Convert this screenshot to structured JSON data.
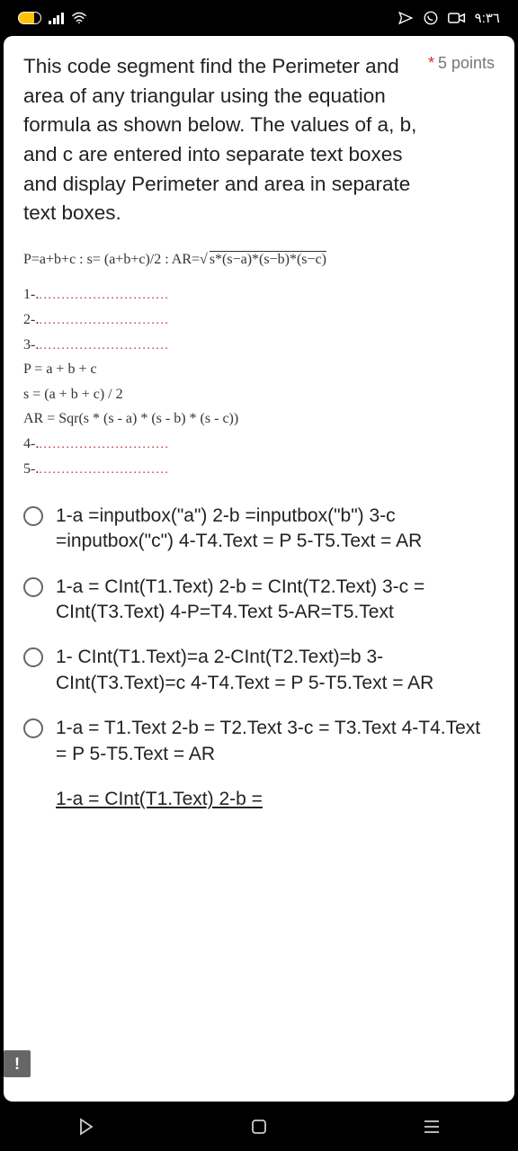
{
  "status": {
    "time": "٩:٣٦"
  },
  "question": {
    "text": "This code segment find the Perimeter and area of any triangular using the equation formula as shown below. The values of a, b, and c are entered into separate text boxes and display Perimeter and area in separate text boxes.",
    "points": "5 points"
  },
  "formula": {
    "main_left": "P=a+b+c :  s= (a+b+c)/2  :  AR=",
    "main_sqrt": "s*(s−a)*(s−b)*(s−c)",
    "line1": "1-.",
    "line2": "2-.",
    "line3": "3-.",
    "p_line": "P = a + b + c",
    "s_line": "s = (a + b + c) / 2",
    "ar_line": "AR = Sqr(s * (s - a) * (s - b) * (s - c))",
    "line4": "4-.",
    "line5": "5-."
  },
  "options": [
    "1-a =inputbox(\"a\") 2-b =inputbox(\"b\") 3-c =inputbox(\"c\") 4-T4.Text = P 5-T5.Text = AR",
    "1-a = CInt(T1.Text) 2-b = CInt(T2.Text) 3-c = CInt(T3.Text) 4-P=T4.Text 5-AR=T5.Text",
    "1- CInt(T1.Text)=a 2-CInt(T2.Text)=b 3-CInt(T3.Text)=c 4-T4.Text = P 5-T5.Text = AR",
    "1-a = T1.Text 2-b = T2.Text 3-c = T3.Text 4-T4.Text = P 5-T5.Text = AR",
    "1-a = CInt(T1.Text) 2-b ="
  ],
  "feedback": "!"
}
